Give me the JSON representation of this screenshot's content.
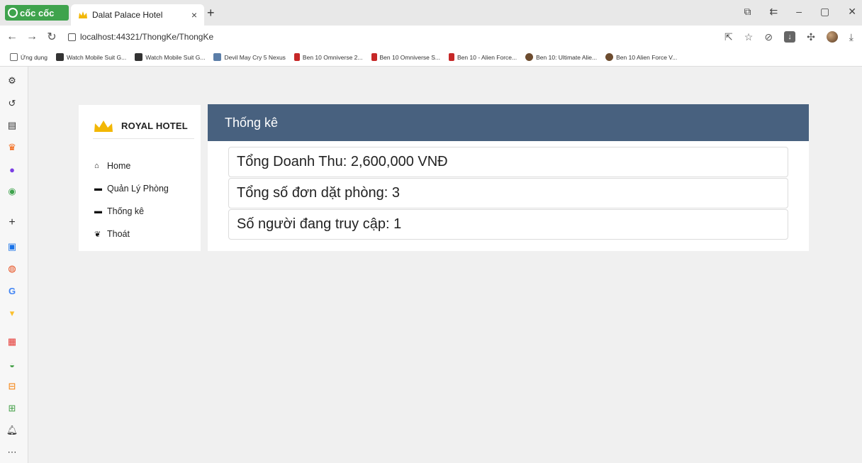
{
  "browser": {
    "brand": "cốc cốc",
    "tab_title": "Dalat Palace Hotel",
    "tab_close": "×",
    "new_tab": "+",
    "url": "localhost:44321/ThongKe/ThongKe"
  },
  "bookmarks": [
    {
      "label": "Ứng dụng",
      "icon": "apps-grid-icon"
    },
    {
      "label": "Watch Mobile Suit G...",
      "icon": "watch-site-icon"
    },
    {
      "label": "Watch Mobile Suit G...",
      "icon": "watch-site-icon"
    },
    {
      "label": "Devil May Cry 5 Nexus",
      "icon": "nexus-icon"
    },
    {
      "label": "Ben 10 Omniverse 2...",
      "icon": "bookmark-red-icon"
    },
    {
      "label": "Ben 10 Omniverse S...",
      "icon": "bookmark-red-icon"
    },
    {
      "label": "Ben 10 - Alien Force...",
      "icon": "bookmark-red-icon"
    },
    {
      "label": "Ben 10: Ultimate Alie...",
      "icon": "bookmark-brown-icon"
    },
    {
      "label": "Ben 10 Alien Force V...",
      "icon": "bookmark-brown-icon"
    }
  ],
  "app": {
    "brand": "ROYAL HOTEL",
    "menu": [
      {
        "icon": "home-icon",
        "label": "Home"
      },
      {
        "icon": "bed-icon",
        "label": "Quản Lý Phòng"
      },
      {
        "icon": "bed-icon",
        "label": "Thống kê"
      },
      {
        "icon": "leaf-icon",
        "label": "Thoát"
      }
    ],
    "panel_title": "Thống kê",
    "stats": [
      "Tổng Doanh Thu: 2,600,000 VNĐ",
      "Tổng số đơn dặt phòng: 3",
      "Số người đang truy cập: 1"
    ]
  },
  "colors": {
    "header": "#48617f",
    "browser_brand": "#3fa34d",
    "crown": "#f2b705"
  }
}
